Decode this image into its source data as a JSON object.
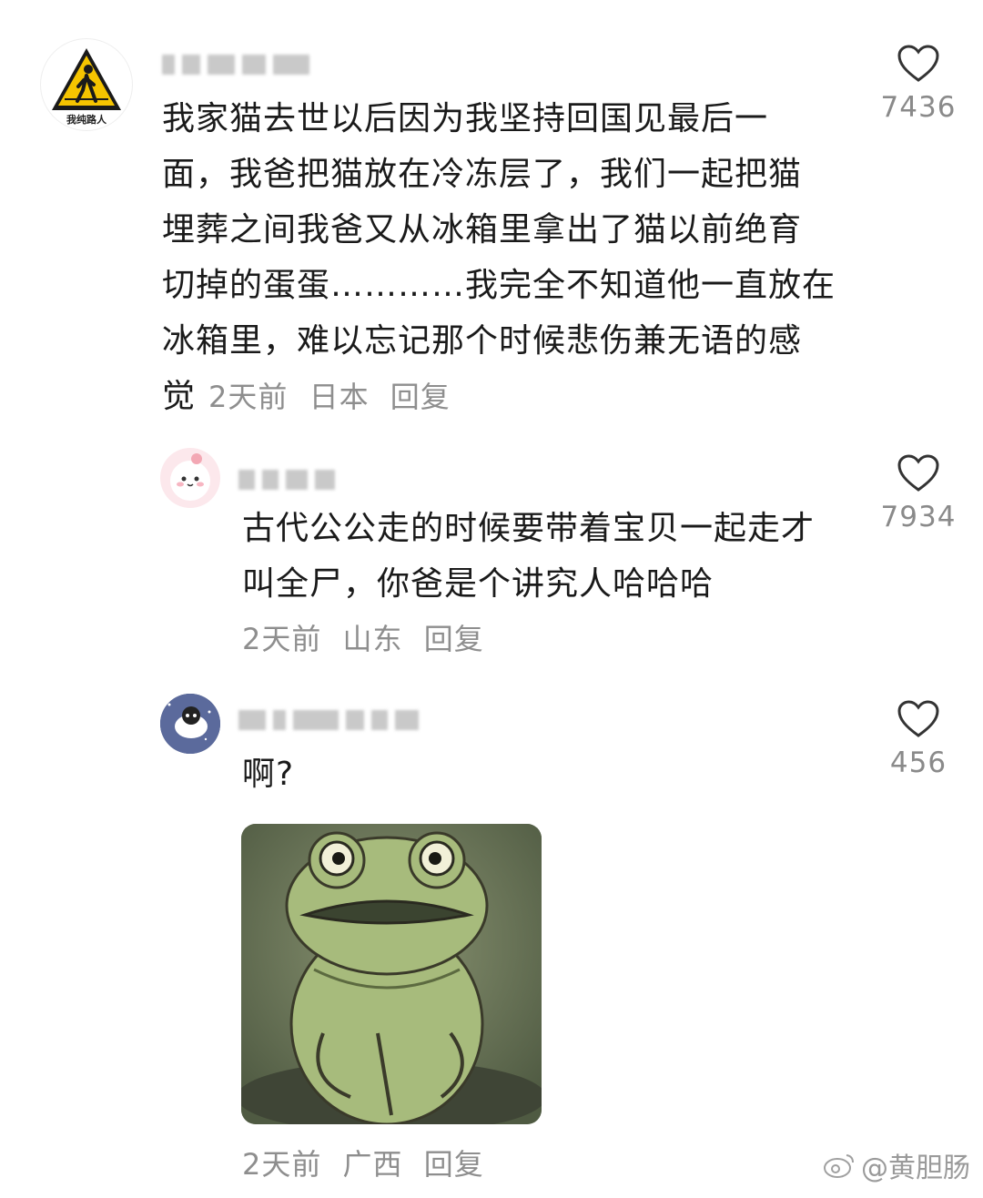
{
  "comments": [
    {
      "text_lines": [
        "我家猫去世以后因为我坚持回国见最后一",
        "面，我爸把猫放在冷冻层了，我们一起把猫",
        "埋葬之间我爸又从冰箱里拿出了猫以前绝育",
        "切掉的蛋蛋…………我完全不知道他一直放在",
        "冰箱里，难以忘记那个时候悲伤兼无语的感",
        "觉"
      ],
      "time": "2天前",
      "location": "日本",
      "reply": "回复",
      "likes": "7436",
      "avatar_badge": "我纯路人"
    },
    {
      "text_lines": [
        "古代公公走的时候要带着宝贝一起走才",
        "叫全尸，你爸是个讲究人哈哈哈"
      ],
      "time": "2天前",
      "location": "山东",
      "reply": "回复",
      "likes": "7934"
    },
    {
      "text_lines": [
        "啊?"
      ],
      "time": "2天前",
      "location": "广西",
      "reply": "回复",
      "likes": "456"
    }
  ],
  "watermark": "@黄胆肠",
  "colors": {
    "meta": "#8e8e8e",
    "text": "#1a1a1a",
    "badge_yellow": "#f5c400"
  },
  "icons": [
    "heart-icon",
    "pedestrian-sign-icon",
    "weibo-icon"
  ]
}
